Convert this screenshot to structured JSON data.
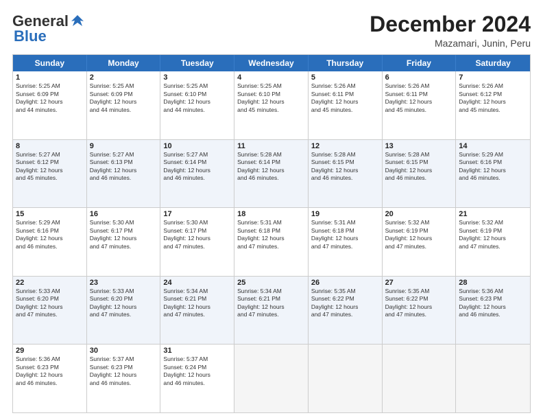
{
  "logo": {
    "line1": "General",
    "line2": "Blue"
  },
  "header": {
    "month_year": "December 2024",
    "location": "Mazamari, Junin, Peru"
  },
  "days_of_week": [
    "Sunday",
    "Monday",
    "Tuesday",
    "Wednesday",
    "Thursday",
    "Friday",
    "Saturday"
  ],
  "weeks": [
    [
      {
        "day": 1,
        "lines": [
          "Sunrise: 5:25 AM",
          "Sunset: 6:09 PM",
          "Daylight: 12 hours",
          "and 44 minutes."
        ]
      },
      {
        "day": 2,
        "lines": [
          "Sunrise: 5:25 AM",
          "Sunset: 6:09 PM",
          "Daylight: 12 hours",
          "and 44 minutes."
        ]
      },
      {
        "day": 3,
        "lines": [
          "Sunrise: 5:25 AM",
          "Sunset: 6:10 PM",
          "Daylight: 12 hours",
          "and 44 minutes."
        ]
      },
      {
        "day": 4,
        "lines": [
          "Sunrise: 5:25 AM",
          "Sunset: 6:10 PM",
          "Daylight: 12 hours",
          "and 45 minutes."
        ]
      },
      {
        "day": 5,
        "lines": [
          "Sunrise: 5:26 AM",
          "Sunset: 6:11 PM",
          "Daylight: 12 hours",
          "and 45 minutes."
        ]
      },
      {
        "day": 6,
        "lines": [
          "Sunrise: 5:26 AM",
          "Sunset: 6:11 PM",
          "Daylight: 12 hours",
          "and 45 minutes."
        ]
      },
      {
        "day": 7,
        "lines": [
          "Sunrise: 5:26 AM",
          "Sunset: 6:12 PM",
          "Daylight: 12 hours",
          "and 45 minutes."
        ]
      }
    ],
    [
      {
        "day": 8,
        "lines": [
          "Sunrise: 5:27 AM",
          "Sunset: 6:12 PM",
          "Daylight: 12 hours",
          "and 45 minutes."
        ]
      },
      {
        "day": 9,
        "lines": [
          "Sunrise: 5:27 AM",
          "Sunset: 6:13 PM",
          "Daylight: 12 hours",
          "and 46 minutes."
        ]
      },
      {
        "day": 10,
        "lines": [
          "Sunrise: 5:27 AM",
          "Sunset: 6:14 PM",
          "Daylight: 12 hours",
          "and 46 minutes."
        ]
      },
      {
        "day": 11,
        "lines": [
          "Sunrise: 5:28 AM",
          "Sunset: 6:14 PM",
          "Daylight: 12 hours",
          "and 46 minutes."
        ]
      },
      {
        "day": 12,
        "lines": [
          "Sunrise: 5:28 AM",
          "Sunset: 6:15 PM",
          "Daylight: 12 hours",
          "and 46 minutes."
        ]
      },
      {
        "day": 13,
        "lines": [
          "Sunrise: 5:28 AM",
          "Sunset: 6:15 PM",
          "Daylight: 12 hours",
          "and 46 minutes."
        ]
      },
      {
        "day": 14,
        "lines": [
          "Sunrise: 5:29 AM",
          "Sunset: 6:16 PM",
          "Daylight: 12 hours",
          "and 46 minutes."
        ]
      }
    ],
    [
      {
        "day": 15,
        "lines": [
          "Sunrise: 5:29 AM",
          "Sunset: 6:16 PM",
          "Daylight: 12 hours",
          "and 46 minutes."
        ]
      },
      {
        "day": 16,
        "lines": [
          "Sunrise: 5:30 AM",
          "Sunset: 6:17 PM",
          "Daylight: 12 hours",
          "and 47 minutes."
        ]
      },
      {
        "day": 17,
        "lines": [
          "Sunrise: 5:30 AM",
          "Sunset: 6:17 PM",
          "Daylight: 12 hours",
          "and 47 minutes."
        ]
      },
      {
        "day": 18,
        "lines": [
          "Sunrise: 5:31 AM",
          "Sunset: 6:18 PM",
          "Daylight: 12 hours",
          "and 47 minutes."
        ]
      },
      {
        "day": 19,
        "lines": [
          "Sunrise: 5:31 AM",
          "Sunset: 6:18 PM",
          "Daylight: 12 hours",
          "and 47 minutes."
        ]
      },
      {
        "day": 20,
        "lines": [
          "Sunrise: 5:32 AM",
          "Sunset: 6:19 PM",
          "Daylight: 12 hours",
          "and 47 minutes."
        ]
      },
      {
        "day": 21,
        "lines": [
          "Sunrise: 5:32 AM",
          "Sunset: 6:19 PM",
          "Daylight: 12 hours",
          "and 47 minutes."
        ]
      }
    ],
    [
      {
        "day": 22,
        "lines": [
          "Sunrise: 5:33 AM",
          "Sunset: 6:20 PM",
          "Daylight: 12 hours",
          "and 47 minutes."
        ]
      },
      {
        "day": 23,
        "lines": [
          "Sunrise: 5:33 AM",
          "Sunset: 6:20 PM",
          "Daylight: 12 hours",
          "and 47 minutes."
        ]
      },
      {
        "day": 24,
        "lines": [
          "Sunrise: 5:34 AM",
          "Sunset: 6:21 PM",
          "Daylight: 12 hours",
          "and 47 minutes."
        ]
      },
      {
        "day": 25,
        "lines": [
          "Sunrise: 5:34 AM",
          "Sunset: 6:21 PM",
          "Daylight: 12 hours",
          "and 47 minutes."
        ]
      },
      {
        "day": 26,
        "lines": [
          "Sunrise: 5:35 AM",
          "Sunset: 6:22 PM",
          "Daylight: 12 hours",
          "and 47 minutes."
        ]
      },
      {
        "day": 27,
        "lines": [
          "Sunrise: 5:35 AM",
          "Sunset: 6:22 PM",
          "Daylight: 12 hours",
          "and 47 minutes."
        ]
      },
      {
        "day": 28,
        "lines": [
          "Sunrise: 5:36 AM",
          "Sunset: 6:23 PM",
          "Daylight: 12 hours",
          "and 46 minutes."
        ]
      }
    ],
    [
      {
        "day": 29,
        "lines": [
          "Sunrise: 5:36 AM",
          "Sunset: 6:23 PM",
          "Daylight: 12 hours",
          "and 46 minutes."
        ]
      },
      {
        "day": 30,
        "lines": [
          "Sunrise: 5:37 AM",
          "Sunset: 6:23 PM",
          "Daylight: 12 hours",
          "and 46 minutes."
        ]
      },
      {
        "day": 31,
        "lines": [
          "Sunrise: 5:37 AM",
          "Sunset: 6:24 PM",
          "Daylight: 12 hours",
          "and 46 minutes."
        ]
      },
      null,
      null,
      null,
      null
    ]
  ]
}
